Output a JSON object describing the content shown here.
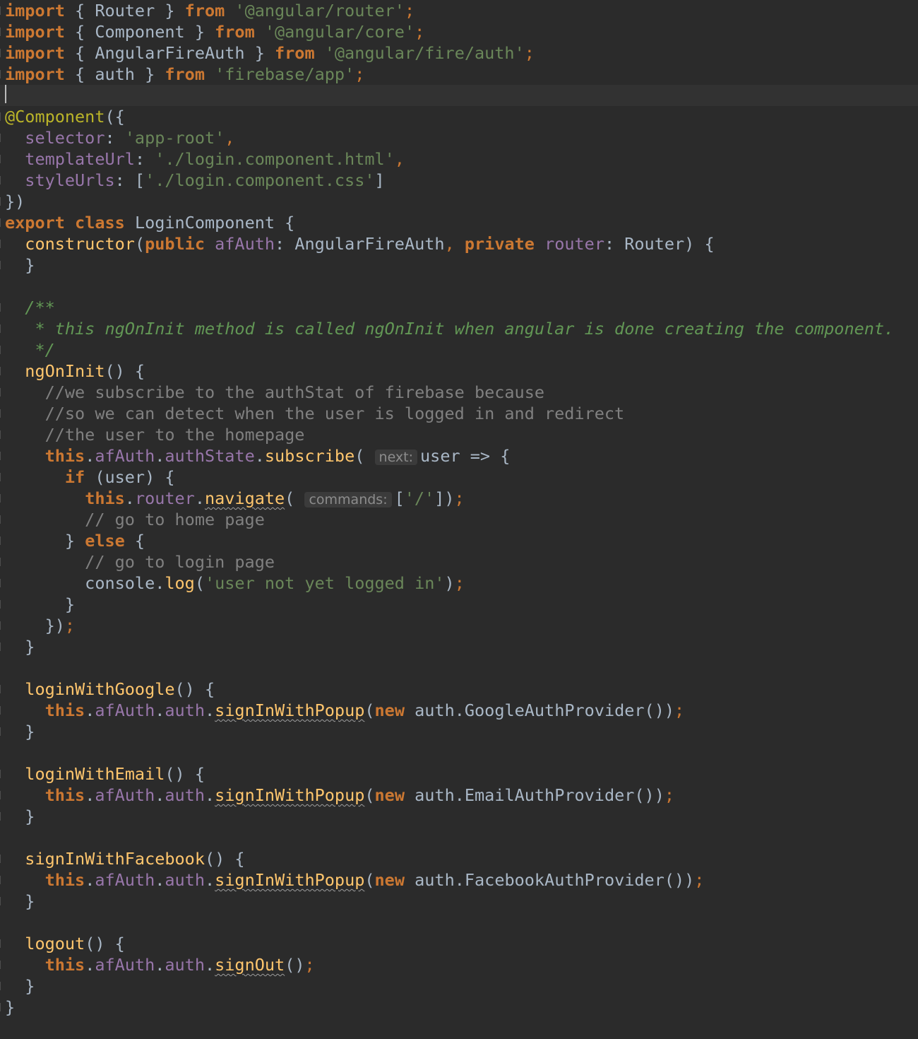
{
  "editor": {
    "theme": "Darcula",
    "colors": {
      "background": "#2b2b2b",
      "keyword": "#cc7832",
      "string": "#6a8759",
      "function": "#ffc66d",
      "property": "#9876aa",
      "annotation": "#bbb529",
      "comment": "#808080",
      "doc_comment": "#629755",
      "identifier": "#a9b7c6"
    },
    "lines": [
      [
        {
          "t": "import",
          "c": "kw"
        },
        {
          "t": " { Router } ",
          "c": "id"
        },
        {
          "t": "from",
          "c": "kw"
        },
        {
          "t": " ",
          "c": "id"
        },
        {
          "t": "'@angular/router'",
          "c": "str"
        },
        {
          "t": ";",
          "c": "semi"
        }
      ],
      [
        {
          "t": "import",
          "c": "kw"
        },
        {
          "t": " { Component } ",
          "c": "id"
        },
        {
          "t": "from",
          "c": "kw"
        },
        {
          "t": " ",
          "c": "id"
        },
        {
          "t": "'@angular/core'",
          "c": "str"
        },
        {
          "t": ";",
          "c": "semi"
        }
      ],
      [
        {
          "t": "import",
          "c": "kw"
        },
        {
          "t": " { AngularFireAuth } ",
          "c": "id"
        },
        {
          "t": "from",
          "c": "kw"
        },
        {
          "t": " ",
          "c": "id"
        },
        {
          "t": "'@angular/fire/auth'",
          "c": "str"
        },
        {
          "t": ";",
          "c": "semi"
        }
      ],
      [
        {
          "t": "import",
          "c": "kw"
        },
        {
          "t": " { auth } ",
          "c": "id"
        },
        {
          "t": "from",
          "c": "kw"
        },
        {
          "t": " ",
          "c": "id"
        },
        {
          "t": "'firebase/app'",
          "c": "str"
        },
        {
          "t": ";",
          "c": "semi"
        }
      ],
      [],
      [
        {
          "t": "@Component",
          "c": "ann"
        },
        {
          "t": "({",
          "c": "pun"
        }
      ],
      [
        {
          "t": "  ",
          "c": "id"
        },
        {
          "t": "selector",
          "c": "prop"
        },
        {
          "t": ": ",
          "c": "pun"
        },
        {
          "t": "'app-root'",
          "c": "str"
        },
        {
          "t": ",",
          "c": "semi"
        }
      ],
      [
        {
          "t": "  ",
          "c": "id"
        },
        {
          "t": "templateUrl",
          "c": "prop"
        },
        {
          "t": ": ",
          "c": "pun"
        },
        {
          "t": "'./login.component.html'",
          "c": "str"
        },
        {
          "t": ",",
          "c": "semi"
        }
      ],
      [
        {
          "t": "  ",
          "c": "id"
        },
        {
          "t": "styleUrls",
          "c": "prop"
        },
        {
          "t": ": [",
          "c": "pun"
        },
        {
          "t": "'./login.component.css'",
          "c": "str"
        },
        {
          "t": "]",
          "c": "pun"
        }
      ],
      [
        {
          "t": "})",
          "c": "pun"
        }
      ],
      [
        {
          "t": "export",
          "c": "kw"
        },
        {
          "t": " ",
          "c": "id"
        },
        {
          "t": "class",
          "c": "kw"
        },
        {
          "t": " LoginComponent {",
          "c": "id"
        }
      ],
      [
        {
          "t": "  ",
          "c": "id"
        },
        {
          "t": "constructor",
          "c": "fn"
        },
        {
          "t": "(",
          "c": "pun"
        },
        {
          "t": "public",
          "c": "kw"
        },
        {
          "t": " ",
          "c": "id"
        },
        {
          "t": "afAuth",
          "c": "prop"
        },
        {
          "t": ": AngularFireAuth",
          "c": "id"
        },
        {
          "t": ",",
          "c": "semi"
        },
        {
          "t": " ",
          "c": "id"
        },
        {
          "t": "private",
          "c": "kw"
        },
        {
          "t": " ",
          "c": "id"
        },
        {
          "t": "router",
          "c": "prop"
        },
        {
          "t": ": Router) {",
          "c": "id"
        }
      ],
      [
        {
          "t": "  }",
          "c": "pun"
        }
      ],
      [],
      [
        {
          "t": "  /**",
          "c": "doc"
        }
      ],
      [
        {
          "t": "   * this ngOnInit method is called ngOnInit when angular is done creating the component.",
          "c": "doc"
        }
      ],
      [
        {
          "t": "   */",
          "c": "doc"
        }
      ],
      [
        {
          "t": "  ",
          "c": "id"
        },
        {
          "t": "ngOnInit",
          "c": "fn"
        },
        {
          "t": "() {",
          "c": "pun"
        }
      ],
      [
        {
          "t": "    //we subscribe to the authStat of firebase because",
          "c": "cm"
        }
      ],
      [
        {
          "t": "    //so we can detect when the user is logged in and redirect",
          "c": "cm"
        }
      ],
      [
        {
          "t": "    //the user to the homepage",
          "c": "cm"
        }
      ],
      [
        {
          "t": "    ",
          "c": "id"
        },
        {
          "t": "this",
          "c": "kw"
        },
        {
          "t": ".",
          "c": "pun"
        },
        {
          "t": "afAuth",
          "c": "prop"
        },
        {
          "t": ".",
          "c": "pun"
        },
        {
          "t": "authState",
          "c": "prop"
        },
        {
          "t": ".",
          "c": "pun"
        },
        {
          "t": "subscribe",
          "c": "fn"
        },
        {
          "t": "( ",
          "c": "pun"
        },
        {
          "t": "next:",
          "c": "hint"
        },
        {
          "t": "user => {",
          "c": "id"
        }
      ],
      [
        {
          "t": "      ",
          "c": "id"
        },
        {
          "t": "if",
          "c": "kw"
        },
        {
          "t": " (user) {",
          "c": "id"
        }
      ],
      [
        {
          "t": "        ",
          "c": "id"
        },
        {
          "t": "this",
          "c": "kw"
        },
        {
          "t": ".",
          "c": "pun"
        },
        {
          "t": "router",
          "c": "prop"
        },
        {
          "t": ".",
          "c": "pun"
        },
        {
          "t": "navigate",
          "c": "fn squig"
        },
        {
          "t": "( ",
          "c": "pun"
        },
        {
          "t": "commands:",
          "c": "hint"
        },
        {
          "t": "[",
          "c": "pun"
        },
        {
          "t": "'/'",
          "c": "str"
        },
        {
          "t": "])",
          "c": "pun"
        },
        {
          "t": ";",
          "c": "semi"
        }
      ],
      [
        {
          "t": "        // go to home page",
          "c": "cm"
        }
      ],
      [
        {
          "t": "      } ",
          "c": "pun"
        },
        {
          "t": "else",
          "c": "kw"
        },
        {
          "t": " {",
          "c": "pun"
        }
      ],
      [
        {
          "t": "        // go to login page",
          "c": "cm"
        }
      ],
      [
        {
          "t": "        console.",
          "c": "id"
        },
        {
          "t": "log",
          "c": "fn"
        },
        {
          "t": "(",
          "c": "pun"
        },
        {
          "t": "'user not yet logged in'",
          "c": "str"
        },
        {
          "t": ")",
          "c": "pun"
        },
        {
          "t": ";",
          "c": "semi"
        }
      ],
      [
        {
          "t": "      }",
          "c": "pun"
        }
      ],
      [
        {
          "t": "    })",
          "c": "pun"
        },
        {
          "t": ";",
          "c": "semi"
        }
      ],
      [
        {
          "t": "  }",
          "c": "pun"
        }
      ],
      [],
      [
        {
          "t": "  ",
          "c": "id"
        },
        {
          "t": "loginWithGoogle",
          "c": "fn"
        },
        {
          "t": "() {",
          "c": "pun"
        }
      ],
      [
        {
          "t": "    ",
          "c": "id"
        },
        {
          "t": "this",
          "c": "kw"
        },
        {
          "t": ".",
          "c": "pun"
        },
        {
          "t": "afAuth",
          "c": "prop"
        },
        {
          "t": ".",
          "c": "pun"
        },
        {
          "t": "auth",
          "c": "prop"
        },
        {
          "t": ".",
          "c": "pun"
        },
        {
          "t": "signInWithPopup",
          "c": "fn squig"
        },
        {
          "t": "(",
          "c": "pun"
        },
        {
          "t": "new",
          "c": "kw"
        },
        {
          "t": " auth.GoogleAuthProvider())",
          "c": "id"
        },
        {
          "t": ";",
          "c": "semi"
        }
      ],
      [
        {
          "t": "  }",
          "c": "pun"
        }
      ],
      [],
      [
        {
          "t": "  ",
          "c": "id"
        },
        {
          "t": "loginWithEmail",
          "c": "fn"
        },
        {
          "t": "() {",
          "c": "pun"
        }
      ],
      [
        {
          "t": "    ",
          "c": "id"
        },
        {
          "t": "this",
          "c": "kw"
        },
        {
          "t": ".",
          "c": "pun"
        },
        {
          "t": "afAuth",
          "c": "prop"
        },
        {
          "t": ".",
          "c": "pun"
        },
        {
          "t": "auth",
          "c": "prop"
        },
        {
          "t": ".",
          "c": "pun"
        },
        {
          "t": "signInWithPopup",
          "c": "fn squig"
        },
        {
          "t": "(",
          "c": "pun"
        },
        {
          "t": "new",
          "c": "kw"
        },
        {
          "t": " auth.EmailAuthProvider())",
          "c": "id"
        },
        {
          "t": ";",
          "c": "semi"
        }
      ],
      [
        {
          "t": "  }",
          "c": "pun"
        }
      ],
      [],
      [
        {
          "t": "  ",
          "c": "id"
        },
        {
          "t": "signInWithFacebook",
          "c": "fn"
        },
        {
          "t": "() {",
          "c": "pun"
        }
      ],
      [
        {
          "t": "    ",
          "c": "id"
        },
        {
          "t": "this",
          "c": "kw"
        },
        {
          "t": ".",
          "c": "pun"
        },
        {
          "t": "afAuth",
          "c": "prop"
        },
        {
          "t": ".",
          "c": "pun"
        },
        {
          "t": "auth",
          "c": "prop"
        },
        {
          "t": ".",
          "c": "pun"
        },
        {
          "t": "signInWithPopup",
          "c": "fn squig"
        },
        {
          "t": "(",
          "c": "pun"
        },
        {
          "t": "new",
          "c": "kw"
        },
        {
          "t": " auth.FacebookAuthProvider())",
          "c": "id"
        },
        {
          "t": ";",
          "c": "semi"
        }
      ],
      [
        {
          "t": "  }",
          "c": "pun"
        }
      ],
      [],
      [
        {
          "t": "  ",
          "c": "id"
        },
        {
          "t": "logout",
          "c": "fn"
        },
        {
          "t": "() {",
          "c": "pun"
        }
      ],
      [
        {
          "t": "    ",
          "c": "id"
        },
        {
          "t": "this",
          "c": "kw"
        },
        {
          "t": ".",
          "c": "pun"
        },
        {
          "t": "afAuth",
          "c": "prop"
        },
        {
          "t": ".",
          "c": "pun"
        },
        {
          "t": "auth",
          "c": "prop"
        },
        {
          "t": ".",
          "c": "pun"
        },
        {
          "t": "signOut",
          "c": "fn squig"
        },
        {
          "t": "()",
          "c": "pun"
        },
        {
          "t": ";",
          "c": "semi"
        }
      ],
      [
        {
          "t": "  }",
          "c": "pun"
        }
      ],
      [
        {
          "t": "}",
          "c": "pun"
        }
      ]
    ]
  }
}
